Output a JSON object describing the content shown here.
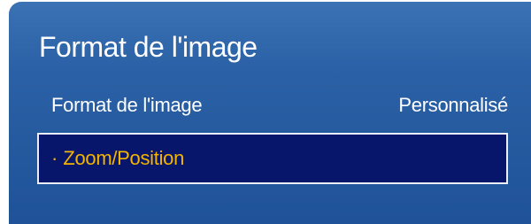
{
  "panel": {
    "title": "Format de l'image"
  },
  "menu": {
    "items": [
      {
        "label": "Format de l'image",
        "value": "Personnalisé"
      },
      {
        "bullet": "·",
        "label": "Zoom/Position"
      }
    ]
  },
  "colors": {
    "panel_top": "#3a72b4",
    "panel_bottom": "#1f5298",
    "selected_bg": "#07166a",
    "selected_text": "#f5b400",
    "text": "#ffffff"
  }
}
